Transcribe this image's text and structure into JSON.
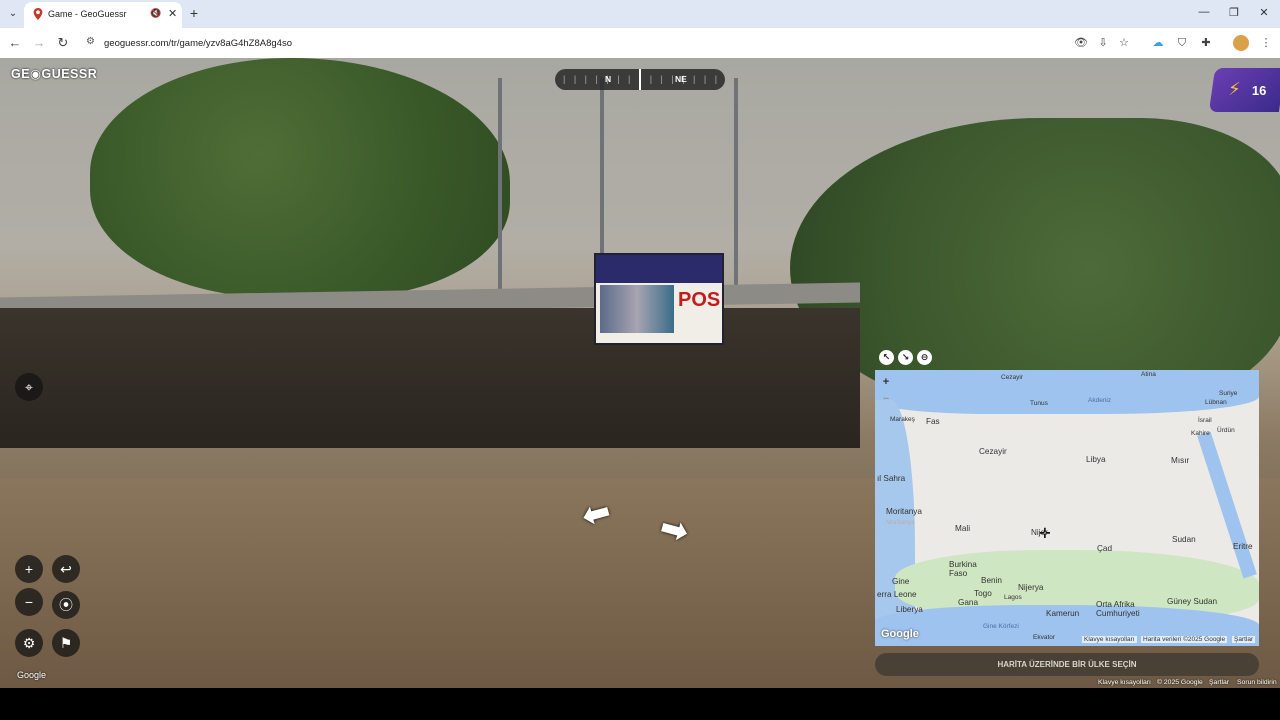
{
  "browser": {
    "tab_title": "Game - GeoGuessr",
    "new_tab_glyph": "+",
    "url": "geoguessr.com/tr/game/yzv8aG4hZ8A8g4so",
    "controls": {
      "minimize": "—",
      "restore": "❐",
      "close": "✕"
    }
  },
  "game": {
    "logo": "GE◉GUESSR",
    "compass": {
      "ticks": "| | | | | | | | | | | | | | |",
      "n": "N",
      "ne": "NE"
    },
    "score": {
      "value": "16",
      "icon": "lightning-icon"
    },
    "billboard_pos": "POS",
    "google_watermark": "Google"
  },
  "map": {
    "labels": {
      "cezayir_top": "Cezayir",
      "tunus": "Tunus",
      "akdeniz": "Akdeniz",
      "atina": "Atina",
      "suriye": "Suriye",
      "lubnan": "Lübnan",
      "israil": "İsrail",
      "urdun": "Ürdün",
      "kahire": "Kahire",
      "marakes": "Marakeş",
      "fas": "Fas",
      "cezayir": "Cezayir",
      "libya": "Libya",
      "misir": "Mısır",
      "sahra": "ıl Sahra",
      "moritanya": "Moritanya",
      "moritanya2": "Moritanya",
      "mali": "Mali",
      "nijer": "Nijer",
      "cad": "Çad",
      "sudan": "Sudan",
      "eritre": "Eritre",
      "burkina": "Burkina\nFaso",
      "gine": "Gine",
      "sierra": "erra Leone",
      "benin": "Benin",
      "togo": "Togo",
      "nijerya": "Nijerya",
      "liberya": "Liberya",
      "gana": "Gana",
      "kamerun": "Kamerun",
      "orta_afrika": "Orta Afrika\nCumhuriyeti",
      "guney_sudan": "Güney Sudan",
      "lagos": "Lagos",
      "gine_korfezi": "Gine Körfezi",
      "ekvator": "Ekvator"
    },
    "footer": {
      "shortcuts": "Klavye kısayolları",
      "data": "Harita verileri ©2025 Google",
      "terms": "Şartlar"
    },
    "google_logo": "Google",
    "guess_button": "HARİTA ÜZERİNDE BİR ÜLKE SEÇİN"
  },
  "footer": {
    "shortcuts": "Klavye kısayolları",
    "copyright": "© 2025 Google",
    "terms": "Şartlar",
    "report": "Sorun bildirin"
  }
}
